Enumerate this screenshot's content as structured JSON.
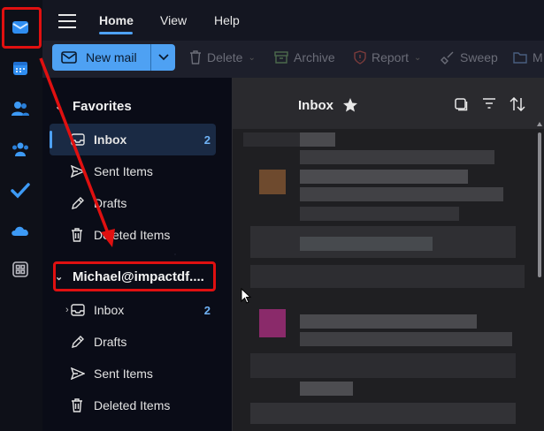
{
  "topbar": {
    "tabs": [
      {
        "label": "Home"
      },
      {
        "label": "View"
      },
      {
        "label": "Help"
      }
    ]
  },
  "ribbon": {
    "new_mail": "New mail",
    "delete": "Delete",
    "archive": "Archive",
    "report": "Report",
    "sweep": "Sweep",
    "move": "M"
  },
  "favorites": {
    "title": "Favorites",
    "items": [
      {
        "label": "Inbox",
        "count": "2",
        "icon": "inbox-icon"
      },
      {
        "label": "Sent Items",
        "icon": "send-icon"
      },
      {
        "label": "Drafts",
        "icon": "pencil-icon"
      },
      {
        "label": "Deleted Items",
        "icon": "trash-icon"
      }
    ]
  },
  "account": {
    "title": "Michael@impactdf....",
    "items": [
      {
        "label": "Inbox",
        "count": "2",
        "icon": "inbox-icon"
      },
      {
        "label": "Drafts",
        "icon": "pencil-icon"
      },
      {
        "label": "Sent Items",
        "icon": "send-icon"
      },
      {
        "label": "Deleted Items",
        "icon": "trash-icon"
      }
    ]
  },
  "list": {
    "title": "Inbox"
  },
  "colors": {
    "accent": "#4ea1f3",
    "annotation": "#e01010"
  }
}
